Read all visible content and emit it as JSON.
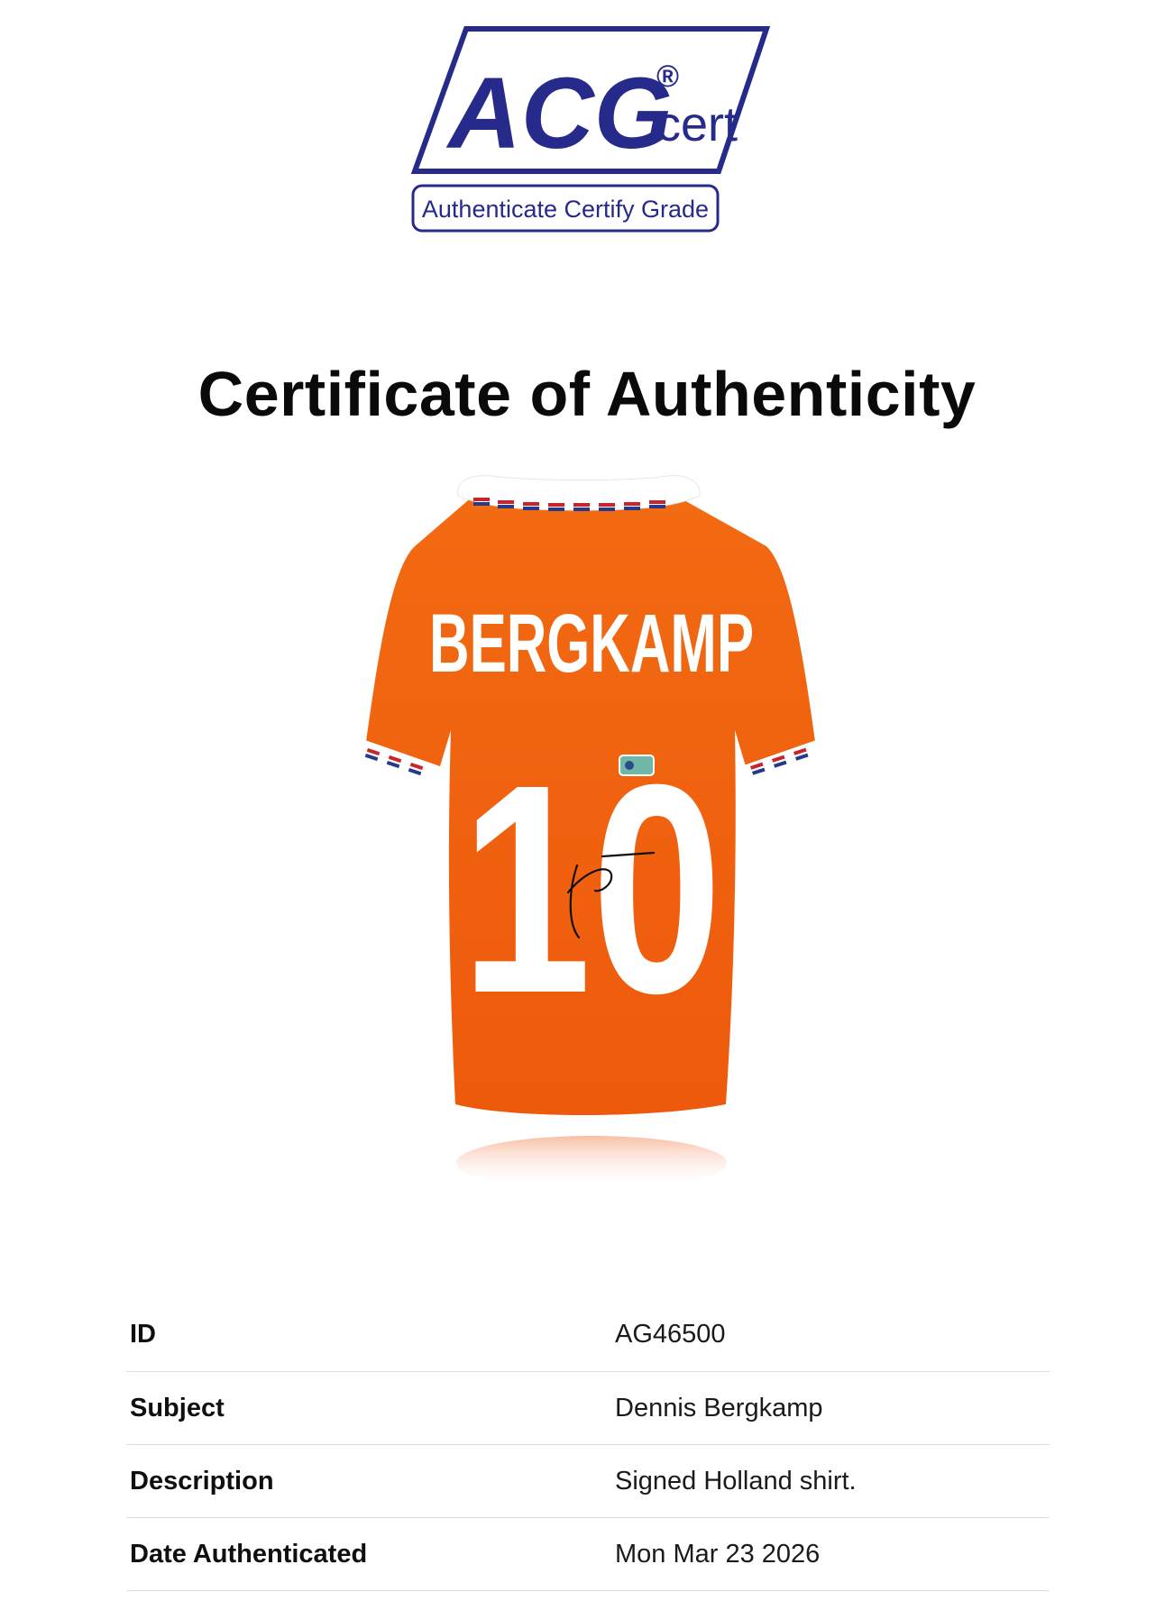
{
  "logo": {
    "brand": "ACG",
    "registered_mark": "®",
    "suffix": "cert",
    "tagline": "Authenticate Certify Grade",
    "color": "#262a8a"
  },
  "title": "Certificate of Authenticity",
  "product_image": {
    "icon": "signed-football-shirt",
    "shirt_name": "BERGKAMP",
    "shirt_number": "10",
    "shirt_color": "#f2620f"
  },
  "details": [
    {
      "label": "ID",
      "value": "AG46500"
    },
    {
      "label": "Subject",
      "value": "Dennis Bergkamp"
    },
    {
      "label": "Description",
      "value": "Signed Holland shirt."
    },
    {
      "label": "Date Authenticated",
      "value": "Mon Mar 23 2026"
    }
  ]
}
